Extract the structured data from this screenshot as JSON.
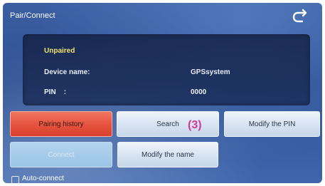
{
  "header": {
    "title": "Pair/Connect",
    "back_icon": "return-arrow-icon"
  },
  "info": {
    "status": "Unpaired",
    "device_name_label": "Device name:",
    "device_name_value": "GPSsystem",
    "pin_label": "PIN    :",
    "pin_value": "0000"
  },
  "buttons": {
    "pairing_history": "Pairing history",
    "search": "Search",
    "modify_pin": "Modify the PIN",
    "connect": "Connect",
    "modify_name": "Modify the name"
  },
  "annotation": "(3)",
  "auto_connect": {
    "label": "Auto-connect",
    "checked": false
  },
  "colors": {
    "accent_red": "#e5523e",
    "status_yellow": "#f1e26a",
    "annotation_magenta": "#d3379a"
  }
}
